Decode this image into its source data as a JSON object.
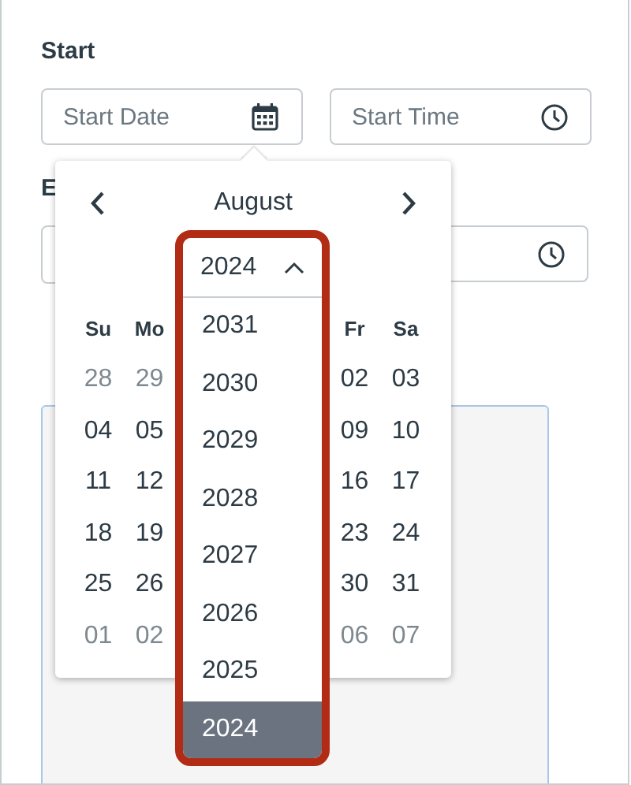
{
  "start": {
    "label": "Start",
    "date_field": {
      "placeholder": "Start Date"
    },
    "time_field": {
      "placeholder": "Start Time"
    }
  },
  "end": {
    "label": "E"
  },
  "calendar": {
    "month": "August",
    "weekdays_left": [
      "Su",
      "Mo"
    ],
    "weekdays_right": [
      "Fr",
      "Sa"
    ],
    "weeks": [
      {
        "left": [
          {
            "day": "28",
            "outside": true
          },
          {
            "day": "29",
            "outside": true
          }
        ],
        "right": [
          {
            "day": "02",
            "outside": false
          },
          {
            "day": "03",
            "outside": false
          }
        ]
      },
      {
        "left": [
          {
            "day": "04",
            "outside": false
          },
          {
            "day": "05",
            "outside": false
          }
        ],
        "right": [
          {
            "day": "09",
            "outside": false
          },
          {
            "day": "10",
            "outside": false
          }
        ]
      },
      {
        "left": [
          {
            "day": "11",
            "outside": false
          },
          {
            "day": "12",
            "outside": false
          }
        ],
        "right": [
          {
            "day": "16",
            "outside": false
          },
          {
            "day": "17",
            "outside": false
          }
        ]
      },
      {
        "left": [
          {
            "day": "18",
            "outside": false
          },
          {
            "day": "19",
            "outside": false
          }
        ],
        "right": [
          {
            "day": "23",
            "outside": false
          },
          {
            "day": "24",
            "outside": false
          }
        ]
      },
      {
        "left": [
          {
            "day": "25",
            "outside": false
          },
          {
            "day": "26",
            "outside": false
          }
        ],
        "right": [
          {
            "day": "30",
            "outside": false
          },
          {
            "day": "31",
            "outside": false
          }
        ]
      },
      {
        "left": [
          {
            "day": "01",
            "outside": true
          },
          {
            "day": "02",
            "outside": true
          }
        ],
        "right": [
          {
            "day": "06",
            "outside": true
          },
          {
            "day": "07",
            "outside": true
          }
        ]
      }
    ],
    "year_select": {
      "value": "2024",
      "expanded": true,
      "options": [
        {
          "label": "2031",
          "selected": false
        },
        {
          "label": "2030",
          "selected": false
        },
        {
          "label": "2029",
          "selected": false
        },
        {
          "label": "2028",
          "selected": false
        },
        {
          "label": "2027",
          "selected": false
        },
        {
          "label": "2026",
          "selected": false
        },
        {
          "label": "2025",
          "selected": false
        },
        {
          "label": "2024",
          "selected": true
        }
      ]
    }
  }
}
